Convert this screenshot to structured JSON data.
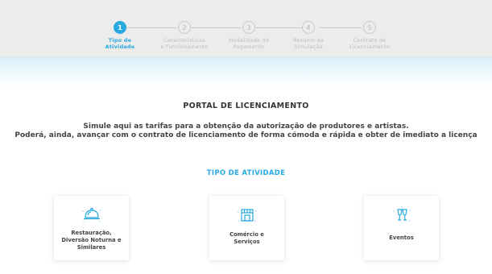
{
  "stepper": {
    "steps": [
      {
        "number": "1",
        "label_line1": "Tipo de",
        "label_line2": "Atividade",
        "active": true
      },
      {
        "number": "2",
        "label_line1": "Características",
        "label_line2": "e Funcionamento",
        "active": false
      },
      {
        "number": "3",
        "label_line1": "Modalidade de",
        "label_line2": "Pagamento",
        "active": false
      },
      {
        "number": "4",
        "label_line1": "Resumo da",
        "label_line2": "Simulação",
        "active": false
      },
      {
        "number": "5",
        "label_line1": "Contrato de",
        "label_line2": "Licenciamento",
        "active": false
      }
    ]
  },
  "main": {
    "title": "PORTAL DE LICENCIAMENTO",
    "intro_line1": "Simule aqui as tarifas para a obtenção da autorização de produtores e artistas.",
    "intro_line2": "Poderá, ainda, avançar com o contrato de licenciamento de forma cómoda e rápida e obter de imediato a licença",
    "section_title": "TIPO DE ATIVIDADE"
  },
  "activities": [
    {
      "line1": "Restauração,",
      "line2": "Diversão Noturna e",
      "line3": "Similares",
      "icon": "cloche-icon"
    },
    {
      "line1": "Comércio e",
      "line2": "Serviços",
      "line3": "",
      "icon": "storefront-icon"
    },
    {
      "line1": "Eventos",
      "line2": "",
      "line3": "",
      "icon": "champagne-glasses-icon"
    }
  ],
  "colors": {
    "accent": "#29a9e0",
    "header_bg": "#ececec",
    "inactive": "#bdbdbd"
  }
}
